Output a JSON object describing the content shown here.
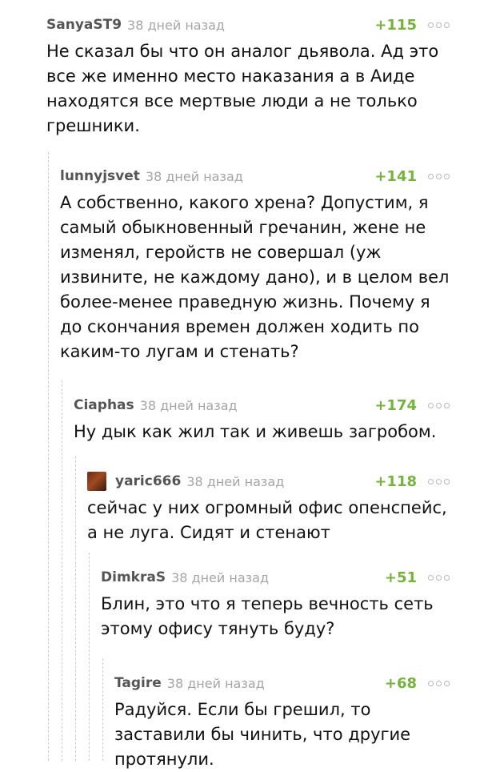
{
  "comments": [
    {
      "username": "SanyaST9",
      "time": "38 дней назад",
      "rating": "+115",
      "text": "Не сказал бы что он аналог дьявола. Ад это все же именно место наказания а в Аиде находятся все мертвые люди а не только грешники."
    },
    {
      "username": "lunnyjsvet",
      "time": "38 дней назад",
      "rating": "+141",
      "text": "А собственно, какого хрена? Допустим, я самый обыкновенный гречанин, жене не изменял, геройств не совершал (уж извините, не каждому дано), и в целом вел более-менее праведную жизнь. Почему я до скончания времен должен ходить по каким-то лугам и стенать?"
    },
    {
      "username": "Ciaphas",
      "time": "38 дней назад",
      "rating": "+174",
      "text": "Ну дык как жил так и живешь загробом."
    },
    {
      "username": "yaric666",
      "time": "38 дней назад",
      "rating": "+118",
      "text": "сейчас у них огромный офис опенспейс, а не луга. Сидят и стенают"
    },
    {
      "username": "DimkraS",
      "time": "38 дней назад",
      "rating": "+51",
      "text": "Блин, это что я теперь вечность сеть этому офису тянуть буду?"
    },
    {
      "username": "Tagire",
      "time": "38 дней назад",
      "rating": "+68",
      "text": "Радуйся. Если бы грешил, то заставили бы чинить, что другие протянули."
    }
  ]
}
